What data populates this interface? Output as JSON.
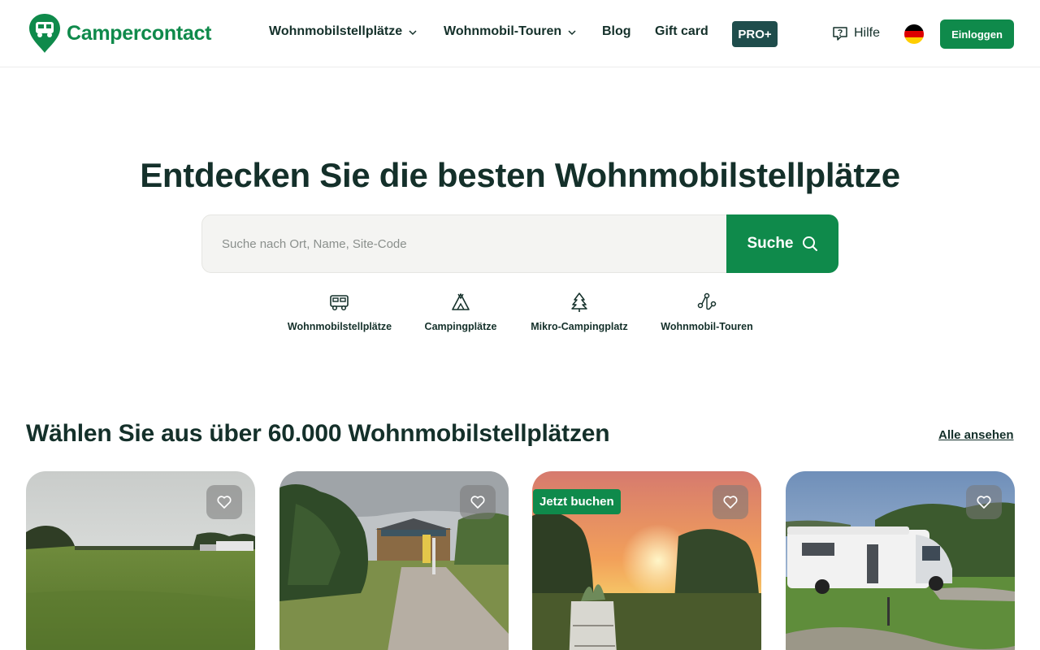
{
  "header": {
    "brand": "Campercontact",
    "nav": [
      {
        "label": "Wohnmobilstellplätze",
        "has_dropdown": true
      },
      {
        "label": "Wohnmobil-Touren",
        "has_dropdown": true
      },
      {
        "label": "Blog",
        "has_dropdown": false
      },
      {
        "label": "Gift card",
        "has_dropdown": false
      }
    ],
    "pro_label": "PRO+",
    "help_label": "Hilfe",
    "language_flag": "germany-flag",
    "login_label": "Einloggen"
  },
  "hero": {
    "title": "Entdecken Sie die besten Wohnmobilstellplätze",
    "search_placeholder": "Suche nach Ort, Name, Site-Code",
    "search_value": "",
    "search_button": "Suche"
  },
  "categories": [
    {
      "label": "Wohnmobilstellplätze",
      "icon": "camper-icon"
    },
    {
      "label": "Campingplätze",
      "icon": "tent-icon"
    },
    {
      "label": "Mikro-Campingplatz",
      "icon": "tree-icon"
    },
    {
      "label": "Wohnmobil-Touren",
      "icon": "route-icon"
    }
  ],
  "section": {
    "title": "Wählen Sie aus über 60.000 Wohnmobilstellplätzen",
    "see_all": "Alle ansehen"
  },
  "cards": [
    {
      "badge": "",
      "favorite_icon": "heart-icon"
    },
    {
      "badge": "",
      "favorite_icon": "heart-icon"
    },
    {
      "badge": "Jetzt buchen",
      "favorite_icon": "heart-icon"
    },
    {
      "badge": "",
      "favorite_icon": "heart-icon"
    }
  ],
  "colors": {
    "brand_green": "#0f8a4b",
    "text_dark": "#14302a",
    "pro_badge": "#1f4d4c"
  }
}
